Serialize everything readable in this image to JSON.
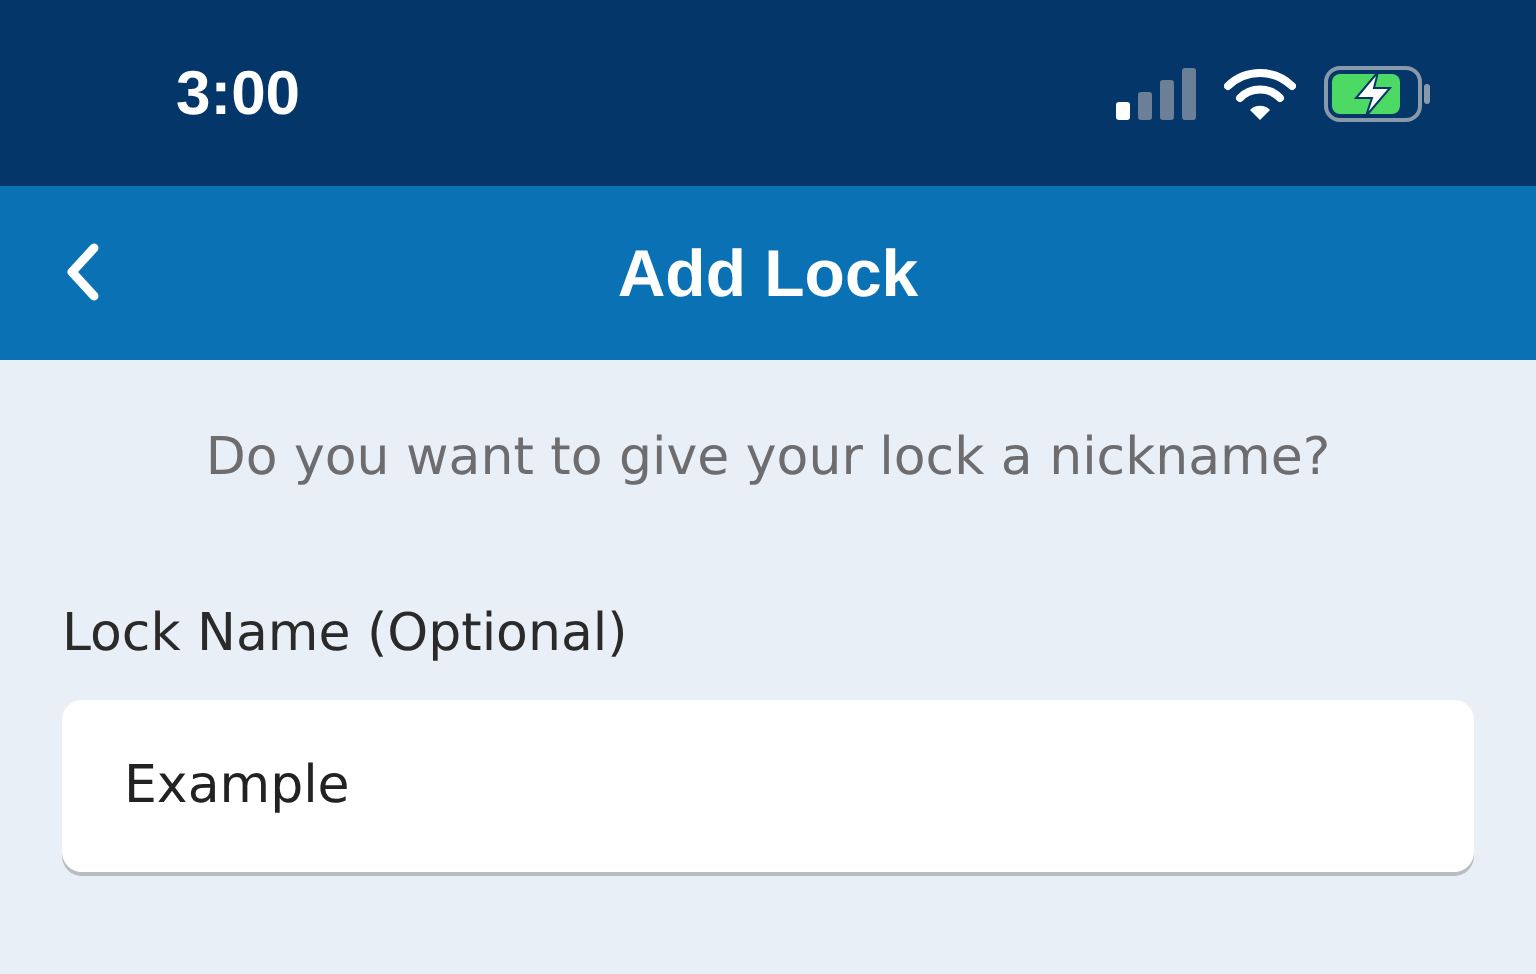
{
  "status_bar": {
    "time": "3:00"
  },
  "header": {
    "title": "Add Lock"
  },
  "prompt": "Do you want to give your lock a nickname?",
  "field": {
    "label": "Lock Name (Optional)",
    "value": "Example"
  }
}
